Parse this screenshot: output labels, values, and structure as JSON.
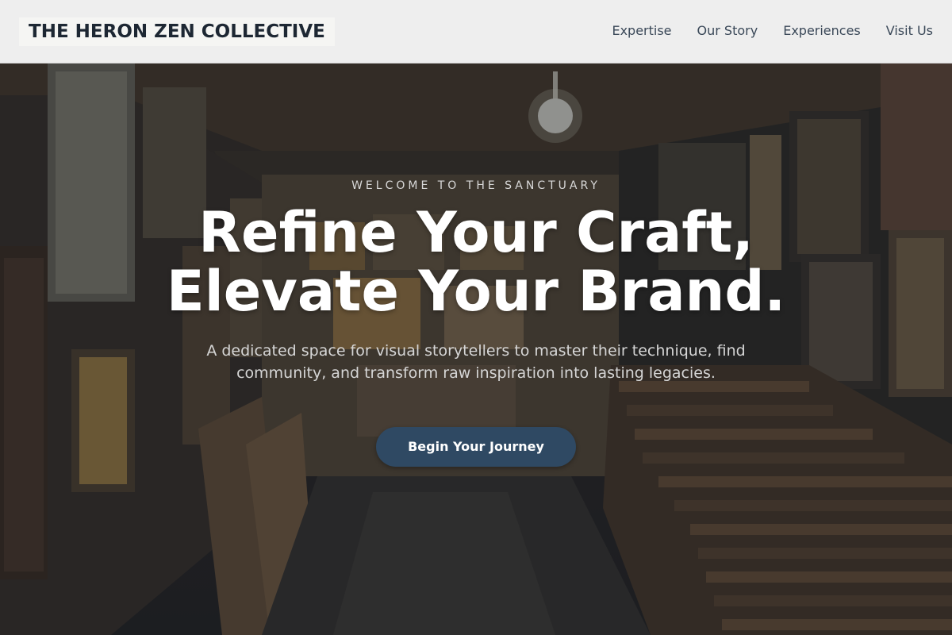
{
  "header": {
    "brand": "THE HERON ZEN COLLECTIVE",
    "nav": [
      "Expertise",
      "Our Story",
      "Experiences",
      "Visit Us"
    ]
  },
  "hero": {
    "eyebrow": "WELCOME TO THE SANCTUARY",
    "headline_line1": "Refine Your Craft,",
    "headline_line2": "Elevate Your Brand.",
    "subheadline": "A dedicated space for visual storytellers to master their technique, find community, and transform raw inspiration into lasting legacies.",
    "cta_label": "Begin Your Journey"
  },
  "colors": {
    "header_bg": "#eeeeee",
    "brand_text": "#1d2733",
    "cta_bg": "#2f4963"
  }
}
